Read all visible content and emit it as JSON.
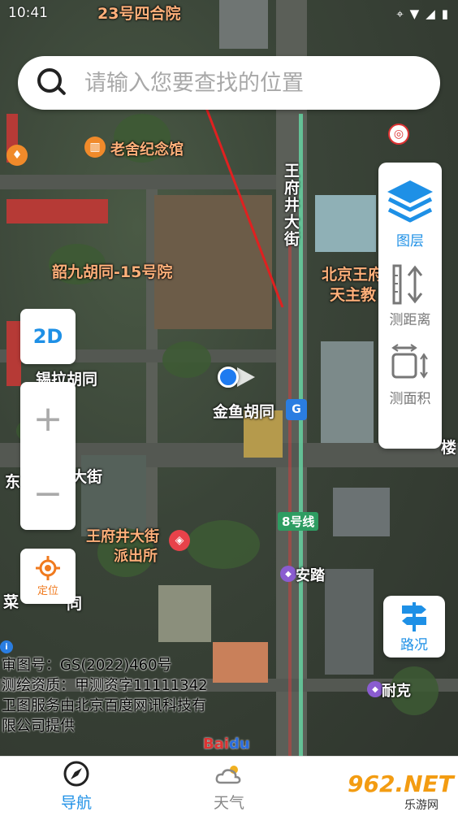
{
  "status_bar": {
    "time": "10:41"
  },
  "search": {
    "placeholder": "请输入您要查找的位置"
  },
  "map": {
    "labels": {
      "l1": "23号四合院",
      "l2": "老舍纪念馆",
      "l3": "韶九胡同-15号院",
      "l4": "锡拉胡同",
      "l5": "金鱼胡同",
      "l6": "王府井大街",
      "l7": "北京王府",
      "l8": "天主教",
      "l9": "王府井大街\n派出所",
      "l9a": "王府井大街",
      "l9b": "派出所",
      "l10": "8号线",
      "l11": "安踏",
      "l12": "耐克",
      "l13": "东",
      "l14": "大街",
      "l15": "菜",
      "l16": "同",
      "l17": "楼"
    }
  },
  "right_panel": {
    "layers_label": "图层",
    "distance_label": "测距离",
    "area_label": "测面积"
  },
  "controls": {
    "mode_label": "2D",
    "zoom_in": "+",
    "zoom_out": "−",
    "locate_label": "定位",
    "traffic_label": "路况"
  },
  "credits": {
    "line1": "审图号：GS(2022)460号",
    "line2": "测绘资质：甲测资字11111342",
    "line3": "卫图服务由北京百度网讯科技有",
    "line4": "限公司提供"
  },
  "tabs": [
    {
      "label": "导航"
    },
    {
      "label": "天气"
    }
  ],
  "watermark": {
    "main": "962.NET",
    "sub": "乐游网"
  },
  "colors": {
    "accent": "#1e90e6",
    "locate": "#f07a1e"
  }
}
